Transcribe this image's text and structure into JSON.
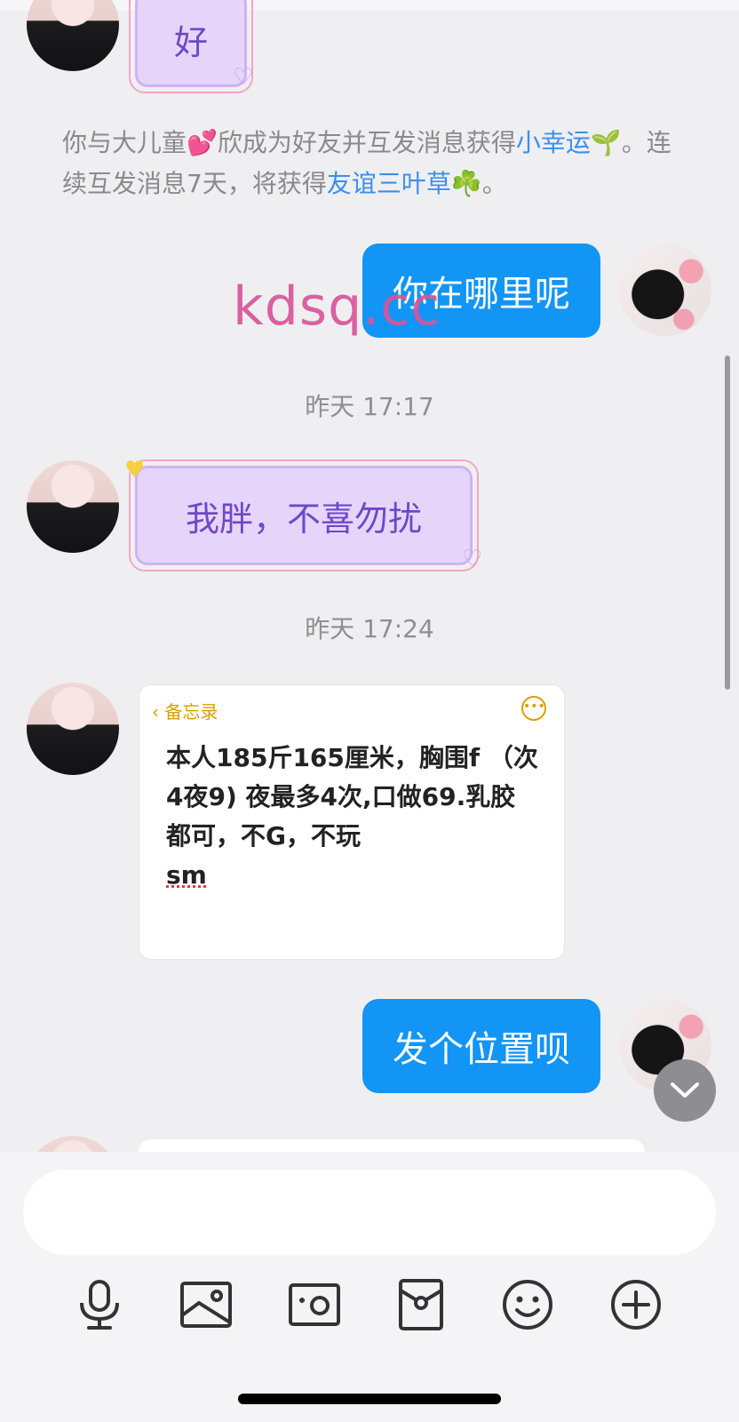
{
  "messages": {
    "top_partial_text": "好",
    "system_notice": {
      "part1": "你与大儿童💕欣成为好友并互发消息获得",
      "link1": "小幸运",
      "part2": "🌱。连续互发消息7天，将获得",
      "link2": "友谊三叶草",
      "part3": "☘️。"
    },
    "outgoing_1": "你在哪里呢",
    "time_1": "昨天 17:17",
    "incoming_1": "我胖，不喜勿扰",
    "time_2": "昨天 17:24",
    "memo": {
      "back_label": "备忘录",
      "line_text": "本人185斤165厘米，胸围f （次4夜9) 夜最多4次,口做69.乳胶都可，不G，不玩",
      "line_sm": "sm"
    },
    "outgoing_2": "发个位置呗"
  },
  "watermark": "kdsq.cc",
  "input": {
    "value": "",
    "placeholder": ""
  },
  "toolbar": {
    "icons": [
      "microphone-icon",
      "image-icon",
      "camera-icon",
      "red-packet-icon",
      "emoji-icon",
      "plus-icon"
    ]
  },
  "colors": {
    "outgoing_bubble": "#1295f5",
    "incoming_bubble": "#e6d5fb",
    "link": "#3b8ff0",
    "watermark": "#d8569a"
  }
}
